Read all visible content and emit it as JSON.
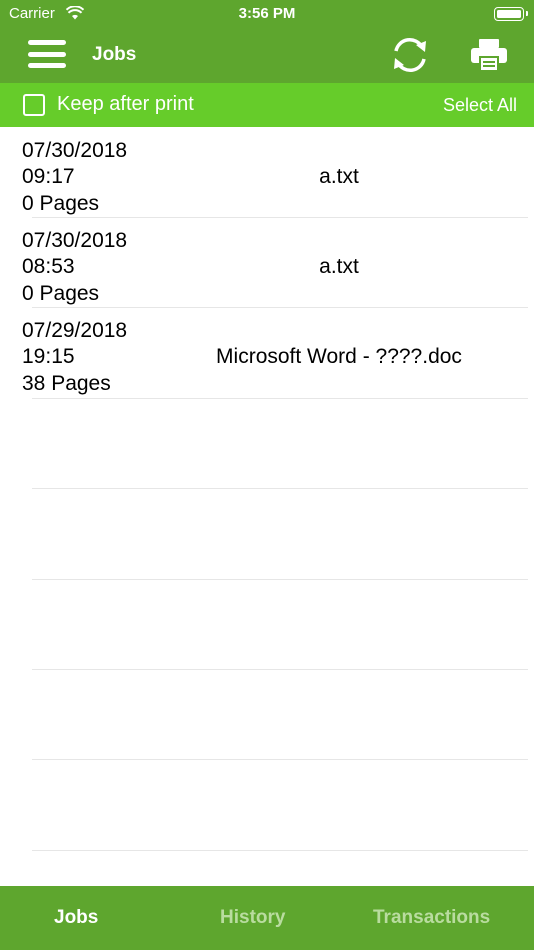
{
  "status_bar": {
    "carrier": "Carrier",
    "time": "3:56 PM"
  },
  "nav": {
    "title": "Jobs",
    "menu_icon": "menu-icon",
    "refresh_icon": "refresh-icon",
    "print_icon": "printer-icon"
  },
  "options": {
    "keep_after_print_label": "Keep after print",
    "keep_after_print_checked": false,
    "select_all_label": "Select All"
  },
  "jobs": [
    {
      "date": "07/30/2018",
      "time": "09:17",
      "pages": "0 Pages",
      "name": "a.txt"
    },
    {
      "date": "07/30/2018",
      "time": "08:53",
      "pages": "0 Pages",
      "name": "a.txt"
    },
    {
      "date": "07/29/2018",
      "time": "19:15",
      "pages": "38 Pages",
      "name": "Microsoft Word - ????.doc"
    }
  ],
  "tabs": [
    {
      "label": "Jobs",
      "active": true
    },
    {
      "label": "History",
      "active": false
    },
    {
      "label": "Transactions",
      "active": false
    }
  ],
  "colors": {
    "header": "#5ea62e",
    "options_bar": "#66cc2a",
    "tab_inactive": "#b9dc9f"
  }
}
